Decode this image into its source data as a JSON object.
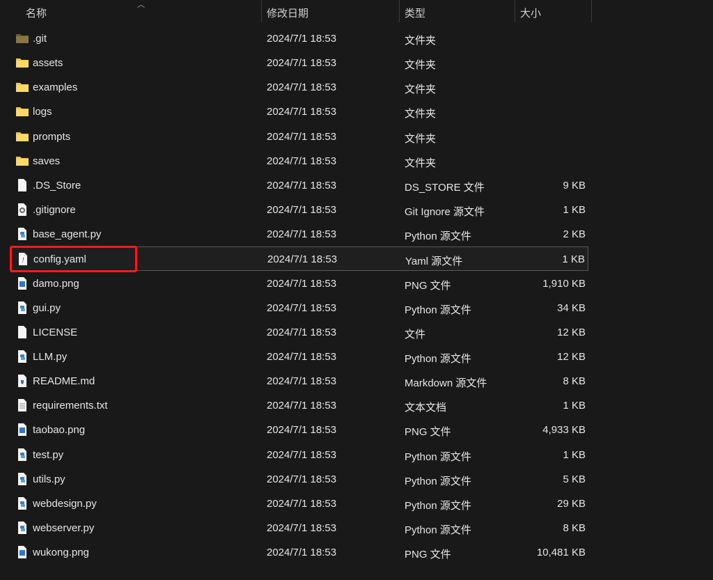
{
  "header": {
    "name": "名称",
    "date": "修改日期",
    "type": "类型",
    "size": "大小"
  },
  "files": [
    {
      "name": ".git",
      "date": "2024/7/1 18:53",
      "type": "文件夹",
      "size": "",
      "icon": "git-folder"
    },
    {
      "name": "assets",
      "date": "2024/7/1 18:53",
      "type": "文件夹",
      "size": "",
      "icon": "folder"
    },
    {
      "name": "examples",
      "date": "2024/7/1 18:53",
      "type": "文件夹",
      "size": "",
      "icon": "folder"
    },
    {
      "name": "logs",
      "date": "2024/7/1 18:53",
      "type": "文件夹",
      "size": "",
      "icon": "folder"
    },
    {
      "name": "prompts",
      "date": "2024/7/1 18:53",
      "type": "文件夹",
      "size": "",
      "icon": "folder"
    },
    {
      "name": "saves",
      "date": "2024/7/1 18:53",
      "type": "文件夹",
      "size": "",
      "icon": "folder"
    },
    {
      "name": ".DS_Store",
      "date": "2024/7/1 18:53",
      "type": "DS_STORE 文件",
      "size": "9 KB",
      "icon": "file"
    },
    {
      "name": ".gitignore",
      "date": "2024/7/1 18:53",
      "type": "Git Ignore 源文件",
      "size": "1 KB",
      "icon": "gear-file"
    },
    {
      "name": "base_agent.py",
      "date": "2024/7/1 18:53",
      "type": "Python 源文件",
      "size": "2 KB",
      "icon": "python"
    },
    {
      "name": "config.yaml",
      "date": "2024/7/1 18:53",
      "type": "Yaml 源文件",
      "size": "1 KB",
      "icon": "yaml",
      "selected": true
    },
    {
      "name": "damo.png",
      "date": "2024/7/1 18:53",
      "type": "PNG 文件",
      "size": "1,910 KB",
      "icon": "image"
    },
    {
      "name": "gui.py",
      "date": "2024/7/1 18:53",
      "type": "Python 源文件",
      "size": "34 KB",
      "icon": "python"
    },
    {
      "name": "LICENSE",
      "date": "2024/7/1 18:53",
      "type": "文件",
      "size": "12 KB",
      "icon": "file"
    },
    {
      "name": "LLM.py",
      "date": "2024/7/1 18:53",
      "type": "Python 源文件",
      "size": "12 KB",
      "icon": "python"
    },
    {
      "name": "README.md",
      "date": "2024/7/1 18:53",
      "type": "Markdown 源文件",
      "size": "8 KB",
      "icon": "markdown"
    },
    {
      "name": "requirements.txt",
      "date": "2024/7/1 18:53",
      "type": "文本文档",
      "size": "1 KB",
      "icon": "text"
    },
    {
      "name": "taobao.png",
      "date": "2024/7/1 18:53",
      "type": "PNG 文件",
      "size": "4,933 KB",
      "icon": "image"
    },
    {
      "name": "test.py",
      "date": "2024/7/1 18:53",
      "type": "Python 源文件",
      "size": "1 KB",
      "icon": "python"
    },
    {
      "name": "utils.py",
      "date": "2024/7/1 18:53",
      "type": "Python 源文件",
      "size": "5 KB",
      "icon": "python"
    },
    {
      "name": "webdesign.py",
      "date": "2024/7/1 18:53",
      "type": "Python 源文件",
      "size": "29 KB",
      "icon": "python"
    },
    {
      "name": "webserver.py",
      "date": "2024/7/1 18:53",
      "type": "Python 源文件",
      "size": "8 KB",
      "icon": "python"
    },
    {
      "name": "wukong.png",
      "date": "2024/7/1 18:53",
      "type": "PNG 文件",
      "size": "10,481 KB",
      "icon": "image"
    }
  ],
  "colors": {
    "highlight": "#ff1a1a",
    "folder": "#f4c542",
    "git_folder": "#7f6a32"
  }
}
